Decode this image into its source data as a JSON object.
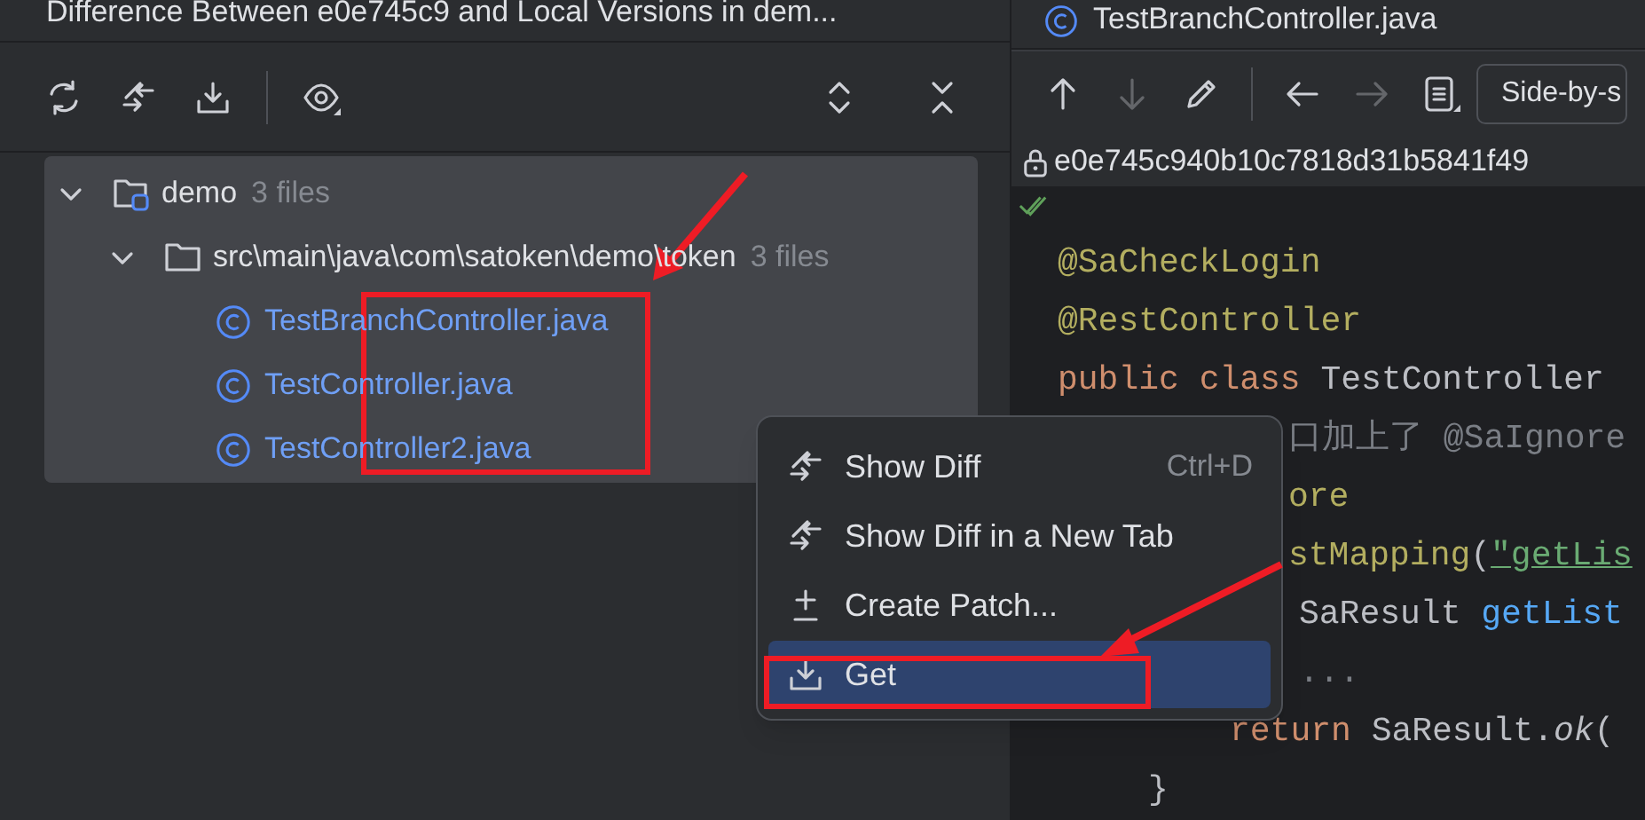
{
  "left_panel": {
    "title": "Difference Between e0e745c9 and Local Versions in dem...",
    "toolbar": [
      {
        "kind": "refresh"
      },
      {
        "kind": "compare"
      },
      {
        "kind": "download"
      },
      {
        "kind": "separator"
      },
      {
        "kind": "view-options"
      }
    ],
    "toolbar_right": [
      {
        "kind": "expand-all"
      },
      {
        "kind": "collapse-all"
      }
    ],
    "tree": [
      {
        "label": "demo",
        "count": "3 files",
        "kind": "module",
        "expanded": true,
        "children": [
          {
            "label": "src\\main\\java\\com\\satoken\\demo\\token",
            "count": "3 files",
            "kind": "folder",
            "expanded": true,
            "children": [
              {
                "label": "TestBranchController.java",
                "kind": "class-file"
              },
              {
                "label": "TestController.java",
                "kind": "class-file"
              },
              {
                "label": "TestController2.java",
                "kind": "class-file"
              }
            ]
          }
        ]
      }
    ]
  },
  "editor": {
    "tab": {
      "label": "TestBranchController.java"
    },
    "toolbar": [
      {
        "kind": "up",
        "disabled": false
      },
      {
        "kind": "down",
        "disabled": true
      },
      {
        "kind": "edit",
        "disabled": false
      },
      {
        "kind": "separator",
        "disabled": false
      },
      {
        "kind": "back",
        "disabled": false
      },
      {
        "kind": "forward",
        "disabled": true
      },
      {
        "kind": "document",
        "disabled": false
      }
    ],
    "view_mode": "Side-by-s",
    "revision": "e0e745c940b10c7818d31b5841f49",
    "code": [
      {
        "tokens": [
          {
            "text": "@SaCheckLogin",
            "kind": "annotation"
          }
        ]
      },
      {
        "tokens": [
          {
            "text": "@RestController",
            "kind": "annotation"
          }
        ]
      },
      {
        "tokens": [
          {
            "text": "public class ",
            "kind": "keyword"
          },
          {
            "text": "TestController",
            "kind": "plain"
          }
        ]
      },
      {
        "tokens": [
          {
            "text": "口加上了 @SaIgnore",
            "kind": "comment"
          }
        ]
      },
      {
        "tokens": [
          {
            "text": "ore",
            "kind": "annotation"
          }
        ]
      },
      {
        "tokens": [
          {
            "text": "stMapping",
            "kind": "annotation"
          },
          {
            "text": "(",
            "kind": "plain"
          },
          {
            "text": "\"getLis",
            "kind": "string"
          }
        ]
      },
      {
        "tokens": [
          {
            "text": "SaResult ",
            "kind": "plain"
          },
          {
            "text": "getList",
            "kind": "method"
          }
        ]
      },
      {
        "tokens": [
          {
            "text": "...",
            "kind": "comment"
          }
        ]
      },
      {
        "tokens": [
          {
            "text": "return ",
            "kind": "keyword"
          },
          {
            "text": "SaResult.",
            "kind": "plain"
          },
          {
            "text": "ok",
            "kind": "italic"
          },
          {
            "text": "(",
            "kind": "plain"
          }
        ]
      },
      {
        "tokens": [
          {
            "text": "}",
            "kind": "plain"
          }
        ]
      }
    ]
  },
  "context_menu": {
    "items": [
      {
        "label": "Show Diff",
        "shortcut": "Ctrl+D",
        "kind": "diff",
        "selected": false
      },
      {
        "label": "Show Diff in a New Tab",
        "kind": "diff",
        "selected": false
      },
      {
        "label": "Create Patch...",
        "kind": "patch",
        "selected": false
      },
      {
        "label": "Get",
        "kind": "download",
        "selected": true
      }
    ]
  }
}
